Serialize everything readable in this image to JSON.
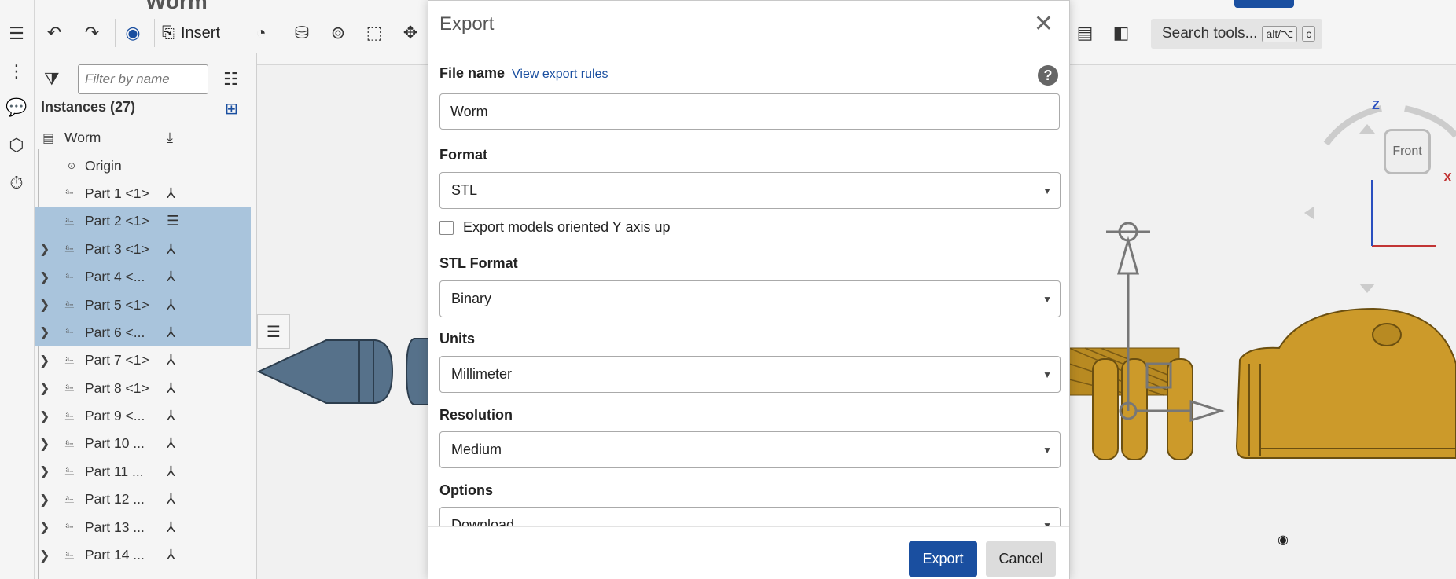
{
  "app": {
    "document_title": "Worm",
    "colors": {
      "accent": "#1a4fa0",
      "selection": "#a9c4dc",
      "model_gold": "#cc9a2a",
      "model_slate": "#56718a"
    }
  },
  "toolbar": {
    "insert_label": "Insert",
    "search_label": "Search tools...",
    "search_kbd_1": "alt/⌥",
    "search_kbd_2": "c",
    "icons": [
      "undo-icon",
      "redo-icon",
      "appearance-icon",
      "insert-icon",
      "mate-connector-icon",
      "cylinder-icon",
      "revolute-icon",
      "part-icon",
      "move-icon",
      "render-icon",
      "fit-icon"
    ]
  },
  "panel": {
    "filter_placeholder": "Filter by name",
    "instances_header": "Instances (27)",
    "tree": [
      {
        "label": "Worm",
        "kind": "root",
        "selected": false,
        "expandable": false
      },
      {
        "label": "Origin",
        "kind": "origin",
        "selected": false,
        "expandable": false
      },
      {
        "label": "Part 1 <1>",
        "kind": "part",
        "selected": false,
        "expandable": false
      },
      {
        "label": "Part 2 <1>",
        "kind": "part",
        "selected": true,
        "expandable": false
      },
      {
        "label": "Part 3 <1>",
        "kind": "part",
        "selected": true,
        "expandable": true
      },
      {
        "label": "Part 4 <...",
        "kind": "part",
        "selected": true,
        "expandable": true
      },
      {
        "label": "Part 5 <1>",
        "kind": "part",
        "selected": true,
        "expandable": true
      },
      {
        "label": "Part 6 <...",
        "kind": "part",
        "selected": true,
        "expandable": true
      },
      {
        "label": "Part 7 <1>",
        "kind": "part",
        "selected": false,
        "expandable": true
      },
      {
        "label": "Part 8 <1>",
        "kind": "part",
        "selected": false,
        "expandable": true
      },
      {
        "label": "Part 9 <...",
        "kind": "part",
        "selected": false,
        "expandable": true
      },
      {
        "label": "Part 10 ...",
        "kind": "part",
        "selected": false,
        "expandable": true
      },
      {
        "label": "Part 11 ...",
        "kind": "part",
        "selected": false,
        "expandable": true
      },
      {
        "label": "Part 12 ...",
        "kind": "part",
        "selected": false,
        "expandable": true
      },
      {
        "label": "Part 13 ...",
        "kind": "part",
        "selected": false,
        "expandable": true
      },
      {
        "label": "Part 14 ...",
        "kind": "part",
        "selected": false,
        "expandable": true
      }
    ]
  },
  "export_dialog": {
    "title": "Export",
    "file_name_label": "File name",
    "view_rules_link": "View export rules",
    "file_name_value": "Worm",
    "format_label": "Format",
    "format_value": "STL",
    "y_axis_up_label": "Export models oriented Y axis up",
    "y_axis_up_checked": false,
    "stl_format_label": "STL Format",
    "stl_format_value": "Binary",
    "units_label": "Units",
    "units_value": "Millimeter",
    "resolution_label": "Resolution",
    "resolution_value": "Medium",
    "options_label": "Options",
    "options_value": "Download",
    "export_button": "Export",
    "cancel_button": "Cancel"
  },
  "viewcube": {
    "front_label": "Front",
    "z_axis": "Z",
    "x_axis": "X"
  }
}
